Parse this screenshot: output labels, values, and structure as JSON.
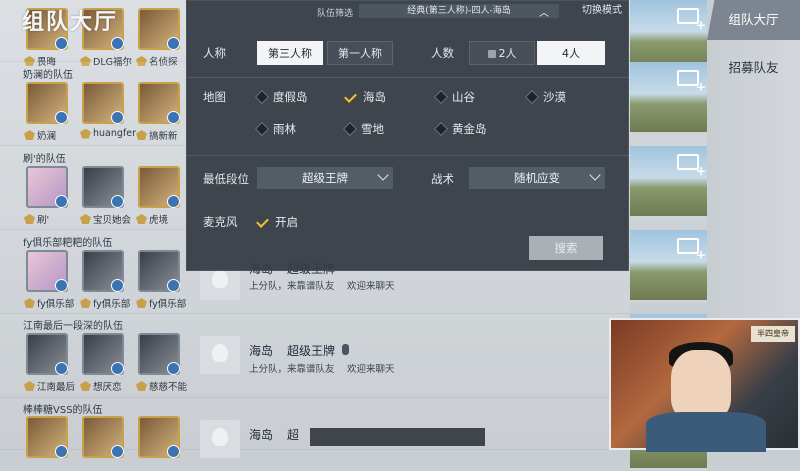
{
  "page_title": "组队大厅",
  "filter_header": {
    "label": "队伍筛选",
    "value": "经典(第三人称)-四人-海岛",
    "mode_text": "切换模式"
  },
  "filter": {
    "perspective_label": "人称",
    "perspective_options": [
      "第三人称",
      "第一人称"
    ],
    "perspective_selected": "第三人称",
    "count_label": "人数",
    "count_options": [
      "2人",
      "4人"
    ],
    "count_selected": "4人",
    "map_label": "地图",
    "maps": [
      {
        "name": "度假岛",
        "checked": false
      },
      {
        "name": "海岛",
        "checked": true
      },
      {
        "name": "山谷",
        "checked": false
      },
      {
        "name": "沙漠",
        "checked": false
      },
      {
        "name": "雨林",
        "checked": false
      },
      {
        "name": "雪地",
        "checked": false
      },
      {
        "name": "黄金岛",
        "checked": false
      }
    ],
    "min_rank_label": "最低段位",
    "min_rank_value": "超级王牌",
    "tactic_label": "战术",
    "tactic_value": "随机应变",
    "mic_label": "麦克风",
    "mic_value": "开启",
    "search_button": "搜索"
  },
  "teams": [
    {
      "name": "",
      "members": [
        "畏晦",
        "DLG福尔",
        "名侦探"
      ]
    },
    {
      "name": "奶澜的队伍",
      "members": [
        "奶澜",
        "huangfer",
        "搞新新"
      ]
    },
    {
      "name": "刷'的队伍",
      "members": [
        "刷'",
        "宝贝她会",
        "虎境"
      ]
    },
    {
      "name": "fy俱乐部粑粑的队伍",
      "members": [
        "fy俱乐部",
        "fy俱乐部",
        "fy俱乐部"
      ]
    },
    {
      "name": "江南最后一段深的队伍",
      "members": [
        "江南最后",
        "想厌恋",
        "慈慈不能"
      ]
    },
    {
      "name": "棒棒糖VSS的队伍",
      "members": [
        "",
        "",
        ""
      ]
    }
  ],
  "rows": [
    {
      "map": "海岛",
      "rank": "超级王牌",
      "desc": "上分队，来靠谱队友",
      "desc2": "欢迎来聊天"
    },
    {
      "map": "海岛",
      "rank": "超级王牌",
      "desc": "上分队，来靠谱队友",
      "desc2": "欢迎来聊天"
    },
    {
      "map": "海岛",
      "rank": "超",
      "desc": "",
      "desc2": ""
    }
  ],
  "tabs": [
    "组队大厅",
    "招募队友"
  ],
  "cam_sign": "半四皇帝"
}
